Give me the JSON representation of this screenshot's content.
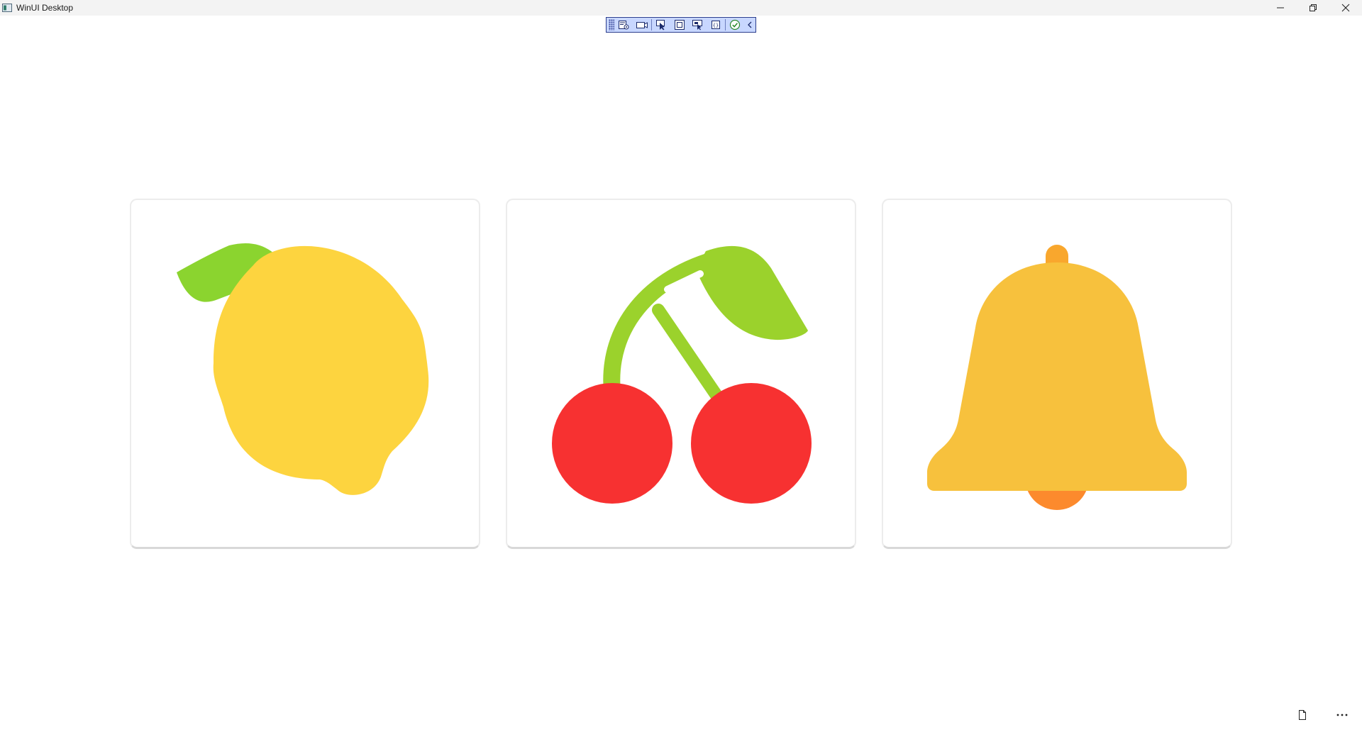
{
  "window": {
    "title": "WinUI Desktop",
    "icons": [
      "app-icon",
      "minimize-icon",
      "restore-icon",
      "close-icon"
    ]
  },
  "debug_toolbar": {
    "icons": [
      "live-visual-tree-icon",
      "record-icon",
      "select-element-icon",
      "display-layout-adorners-icon",
      "track-focus-icon",
      "binding-failures-icon",
      "hot-reload-status-icon",
      "collapse-icon"
    ]
  },
  "cards": [
    {
      "symbol": "lemon",
      "colors": {
        "body": "#fdd43f",
        "leaf": "#8bd42f"
      }
    },
    {
      "symbol": "cherry",
      "colors": {
        "fruit": "#f73131",
        "stem": "#9bd22c"
      }
    },
    {
      "symbol": "bell",
      "colors": {
        "body": "#f7c13d",
        "clapper": "#fc8a2d",
        "top": "#f9a72d"
      }
    }
  ],
  "bottom_bar": {
    "icons": [
      "page-icon",
      "more-options-icon"
    ]
  }
}
